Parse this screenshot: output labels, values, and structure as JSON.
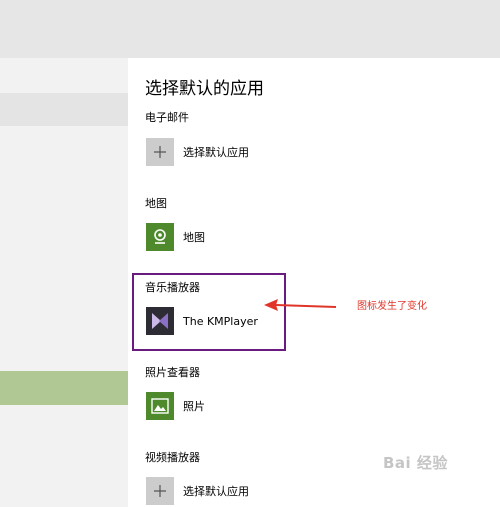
{
  "page_title": "选择默认的应用",
  "sections": [
    {
      "label": "电子邮件",
      "app": "选择默认应用",
      "icon": "plus-icon"
    },
    {
      "label": "地图",
      "app": "地图",
      "icon": "map-pin-icon"
    },
    {
      "label": "音乐播放器",
      "app": "The KMPlayer",
      "icon": "kmplayer-icon"
    },
    {
      "label": "照片查看器",
      "app": "照片",
      "icon": "photo-icon"
    },
    {
      "label": "视频播放器",
      "app": "选择默认应用",
      "icon": "plus-icon"
    }
  ],
  "annotation": "图标发生了变化",
  "watermark": "Bai 经验",
  "colors": {
    "accent_green": "#4e8a2c",
    "selected_nav": "#b0c994",
    "annotation_red": "#e0362a",
    "highlight_purple": "#6a1b7e"
  }
}
